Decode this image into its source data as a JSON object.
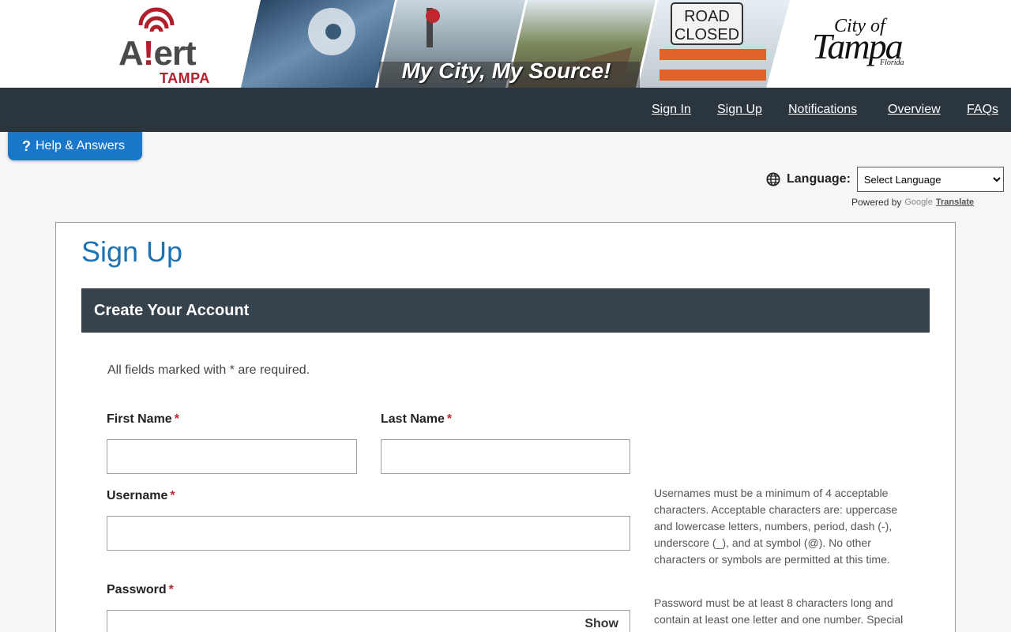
{
  "banner": {
    "alert_logo_word": "A!ert",
    "alert_logo_sub": "TAMPA",
    "tagline": "My City, My Source!",
    "road_sign_line1": "ROAD",
    "road_sign_line2": "CLOSED",
    "city_logo_city": "City of",
    "city_logo_tampa": "Tampa",
    "city_logo_florida": "Florida"
  },
  "nav": {
    "items": [
      {
        "label": "Sign In"
      },
      {
        "label": "Sign Up"
      },
      {
        "label": "Notifications"
      },
      {
        "label": "Overview"
      },
      {
        "label": "FAQs"
      }
    ]
  },
  "help_button": {
    "icon": "question-icon",
    "label": "Help & Answers"
  },
  "language": {
    "icon": "globe-icon",
    "label": "Language:",
    "selected": "Select Language",
    "powered_by": "Powered by",
    "google": "Google",
    "translate": "Translate"
  },
  "form": {
    "title": "Sign Up",
    "section": "Create Your Account",
    "required_note": "All fields marked with * are required.",
    "required_marker": "*",
    "first_name_label": "First Name",
    "last_name_label": "Last Name",
    "username_label": "Username",
    "password_label": "Password",
    "first_name_value": "",
    "last_name_value": "",
    "username_value": "",
    "password_value": "",
    "show_label": "Show",
    "username_help": "Usernames must be a minimum of 4 acceptable characters. Acceptable characters are: uppercase and lowercase letters, numbers, period, dash (-), underscore (_), and at symbol (@). No other characters or symbols are permitted at this time.",
    "password_help": "Password must be at least 8 characters long and contain at least one letter and one number. Special"
  },
  "colors": {
    "nav_bg": "#2b353d",
    "accent": "#1a77c9",
    "title": "#1a73b5",
    "section_bg": "#37434c",
    "required": "#c0262d",
    "brand_red": "#b11f2d"
  }
}
